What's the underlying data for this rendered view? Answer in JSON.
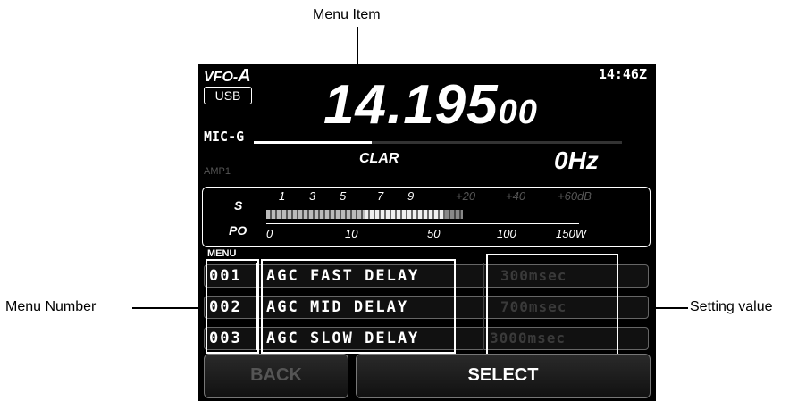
{
  "callouts": {
    "menu_item": "Menu Item",
    "menu_number": "Menu Number",
    "setting_value": "Setting value"
  },
  "display": {
    "vfo_prefix": "VFO-",
    "vfo_letter": "A",
    "time": "14:46Z",
    "mode": "USB",
    "mic_label": "MIC-G",
    "frequency_main": "14.195",
    "frequency_sub": "00",
    "clar_label": "CLAR",
    "clar_value": "0Hz",
    "amp_label": "AMP1",
    "meter": {
      "s_label": "S",
      "po_label": "PO",
      "s_ticks": [
        "1",
        "3",
        "5",
        "7",
        "9",
        "+20",
        "+40",
        "+60dB"
      ],
      "po_ticks": [
        "0",
        "10",
        "50",
        "100",
        "150W"
      ]
    },
    "menu_label": "MENU",
    "menu_rows": [
      {
        "number": "001",
        "item": "AGC FAST DELAY",
        "setting": "300msec"
      },
      {
        "number": "002",
        "item": "AGC MID DELAY",
        "setting": "700msec"
      },
      {
        "number": "003",
        "item": "AGC SLOW DELAY",
        "setting": "3000msec"
      }
    ],
    "back_label": "BACK",
    "select_label": "SELECT"
  },
  "colors": {
    "screen_bg": "#000000",
    "text": "#ffffff",
    "dim_text": "#3a3a3a"
  }
}
